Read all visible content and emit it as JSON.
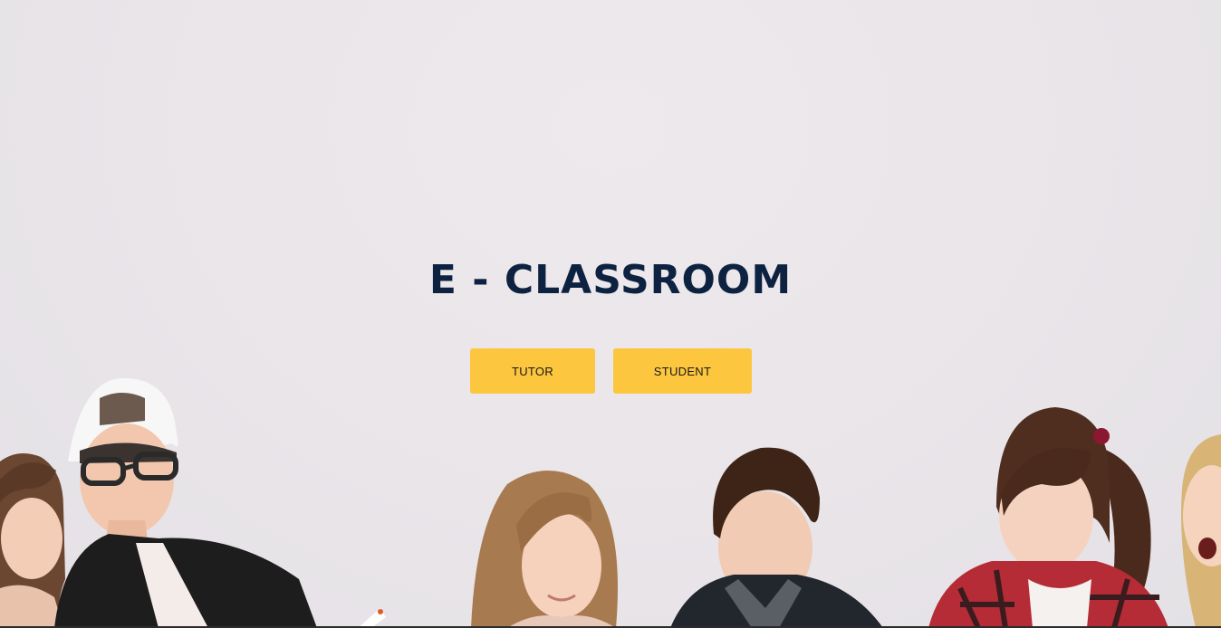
{
  "hero": {
    "title": "E - CLASSROOM"
  },
  "buttons": {
    "tutor_label": "TUTOR",
    "student_label": "STUDENT"
  },
  "colors": {
    "accent": "#fcc63f",
    "title": "#0d2240",
    "background": "#ece8eb"
  }
}
